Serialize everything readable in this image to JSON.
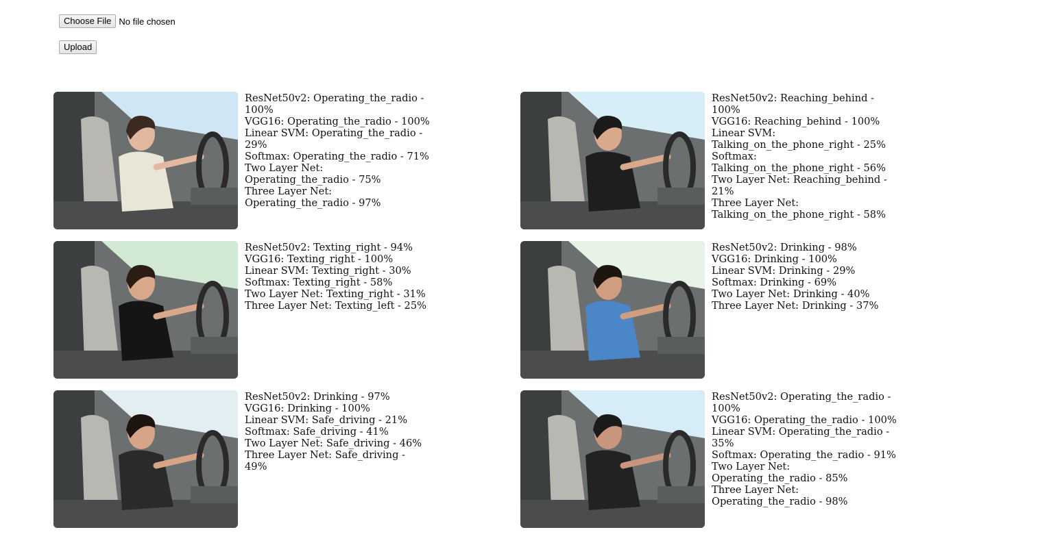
{
  "form": {
    "choose_file_label": "Choose File",
    "file_status": "No file chosen",
    "upload_label": "Upload"
  },
  "results": [
    {
      "image_icon": "driver-photo",
      "predictions": [
        "ResNet50v2: Operating_the_radio - 100%",
        "VGG16: Operating_the_radio - 100%",
        "Linear SVM: Operating_the_radio - 29%",
        "Softmax: Operating_the_radio - 71%",
        "Two Layer Net: Operating_the_radio - 75%",
        "Three Layer Net: Operating_the_radio - 97%"
      ]
    },
    {
      "image_icon": "driver-photo",
      "predictions": [
        "ResNet50v2: Reaching_behind - 100%",
        "VGG16: Reaching_behind - 100%",
        "Linear SVM: Talking_on_the_phone_right - 25%",
        "Softmax: Talking_on_the_phone_right - 56%",
        "Two Layer Net: Reaching_behind - 21%",
        "Three Layer Net: Talking_on_the_phone_right - 58%"
      ]
    },
    {
      "image_icon": "driver-photo",
      "predictions": [
        "ResNet50v2: Texting_right - 94%",
        "VGG16: Texting_right - 100%",
        "Linear SVM: Texting_right - 30%",
        "Softmax: Texting_right - 58%",
        "Two Layer Net: Texting_right - 31%",
        "Three Layer Net: Texting_left - 25%"
      ]
    },
    {
      "image_icon": "driver-photo",
      "predictions": [
        "ResNet50v2: Drinking - 98%",
        "VGG16: Drinking - 100%",
        "Linear SVM: Drinking - 29%",
        "Softmax: Drinking - 69%",
        "Two Layer Net: Drinking - 40%",
        "Three Layer Net: Drinking - 37%"
      ]
    },
    {
      "image_icon": "driver-photo",
      "predictions": [
        "ResNet50v2: Drinking - 97%",
        "VGG16: Drinking - 100%",
        "Linear SVM: Safe_driving - 21%",
        "Softmax: Safe_driving - 41%",
        "Two Layer Net: Safe_driving - 46%",
        "Three Layer Net: Safe_driving - 49%"
      ]
    },
    {
      "image_icon": "driver-photo",
      "predictions": [
        "ResNet50v2: Operating_the_radio - 100%",
        "VGG16: Operating_the_radio - 100%",
        "Linear SVM: Operating_the_radio - 35%",
        "Softmax: Operating_the_radio - 91%",
        "Two Layer Net: Operating_the_radio - 85%",
        "Three Layer Net: Operating_the_radio - 98%"
      ]
    }
  ]
}
